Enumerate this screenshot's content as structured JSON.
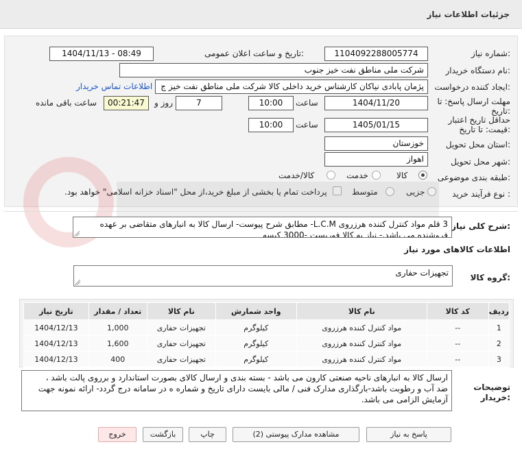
{
  "header": {
    "title": "جزئیات اطلاعات نیاز"
  },
  "form": {
    "need_number": {
      "label": "شماره نیاز:",
      "value": "1104092288005774"
    },
    "announce": {
      "label": "تاریخ و ساعت اعلان عمومی:",
      "value": "1404/11/13 - 08:49"
    },
    "buyer_org": {
      "label": "نام دستگاه خریدار:",
      "value": "شرکت ملی مناطق نفت خیز جنوب"
    },
    "requester": {
      "label": "ایجاد کننده درخواست:",
      "value": "پژمان  پابادی نیاکان  کارشناس خرید داخلی کالا  شرکت ملی مناطق نفت خیز ج",
      "contact_link": "اطلاعات تماس خریدار"
    },
    "deadline": {
      "label_line1": "مهلت ارسال پاسخ: تا",
      "label_line2": "تاریخ:",
      "date": "1404/11/20",
      "time_label": "ساعت",
      "time": "10:00",
      "days": "7",
      "days_label": "روز و",
      "remaining": "00:21:47",
      "remaining_label": "ساعت باقی مانده"
    },
    "validity": {
      "label_line1": "حداقل تاریخ اعتبار",
      "label_line2": "قیمت: تا تاریخ:",
      "date": "1405/01/15",
      "time_label": "ساعت",
      "time": "10:00"
    },
    "province": {
      "label": "استان محل تحویل:",
      "value": "خوزستان"
    },
    "city": {
      "label": "شهر محل تحویل:",
      "value": "اهواز"
    },
    "category": {
      "label": "طبقه بندی موضوعی:",
      "options": [
        "کالا",
        "خدمت",
        "کالا/خدمت"
      ],
      "selected": "کالا"
    },
    "purchase_type": {
      "label": "نوع فرآیند خرید :",
      "options": [
        "جزیی",
        "متوسط"
      ],
      "selected": "",
      "payment_note": "پرداخت تمام یا بخشی از مبلغ خرید،از محل \"اسناد خزانه اسلامی\" خواهد بود."
    }
  },
  "description": {
    "label": "شرح کلی نیاز:",
    "line1": "3 قلم مواد کنترل کننده هرزروی L.C.M- مطابق شرح پیوست- ارسال کالا به انبارهای متقاضی بر عهده",
    "line2": "فروشنده می باشد.- نیاز به کالا فوریست -3000 کیسه"
  },
  "goods_info": {
    "title": "اطلاعات کالاهای مورد نیاز",
    "group_label": "گروه کالا:",
    "group_value": "تجهیزات حفاری"
  },
  "table": {
    "headers": [
      "ردیف",
      "کد کالا",
      "نام کالا",
      "واحد شمارش",
      "نام کالا",
      "تعداد / مقدار",
      "تاریخ نیاز"
    ],
    "rows": [
      [
        "1",
        "--",
        "مواد کنترل کننده هرزروی",
        "کیلوگرم",
        "تجهیزات حفاری",
        "1,000",
        "1404/12/13"
      ],
      [
        "2",
        "--",
        "مواد کنترل کننده هرزروی",
        "کیلوگرم",
        "تجهیزات حفاری",
        "1,600",
        "1404/12/13"
      ],
      [
        "3",
        "--",
        "مواد کنترل کننده هرزروی",
        "کیلوگرم",
        "تجهیزات حفاری",
        "400",
        "1404/12/13"
      ]
    ]
  },
  "buyer_notes": {
    "label_line1": "توضیحات",
    "label_line2": "خریدار:",
    "line1": "ارسال کالا به انبارهای  ناحیه صنعتی  کارون می باشد  - بسته بندی و ارسال کالای بصورت استاندارد و برروی پالت باشد ،",
    "line2": "ضد آب و رطوبت باشد-بارگذاری مدارک فنی / مالی بایست دارای تاریخ و شماره ه در سامانه درج گردد- ارائه نمونه جهت",
    "line3": "آزمایش الزامی می باشد."
  },
  "buttons": {
    "respond": "پاسخ به نیاز",
    "view_docs": "مشاهده مدارک پیوستی (2)",
    "print": "چاپ",
    "back": "بازگشت",
    "exit": "خروج"
  },
  "colors": {
    "link": "#1a56c8",
    "remaining_bg": "#fafad2",
    "exit_bg": "#fde7e7"
  }
}
